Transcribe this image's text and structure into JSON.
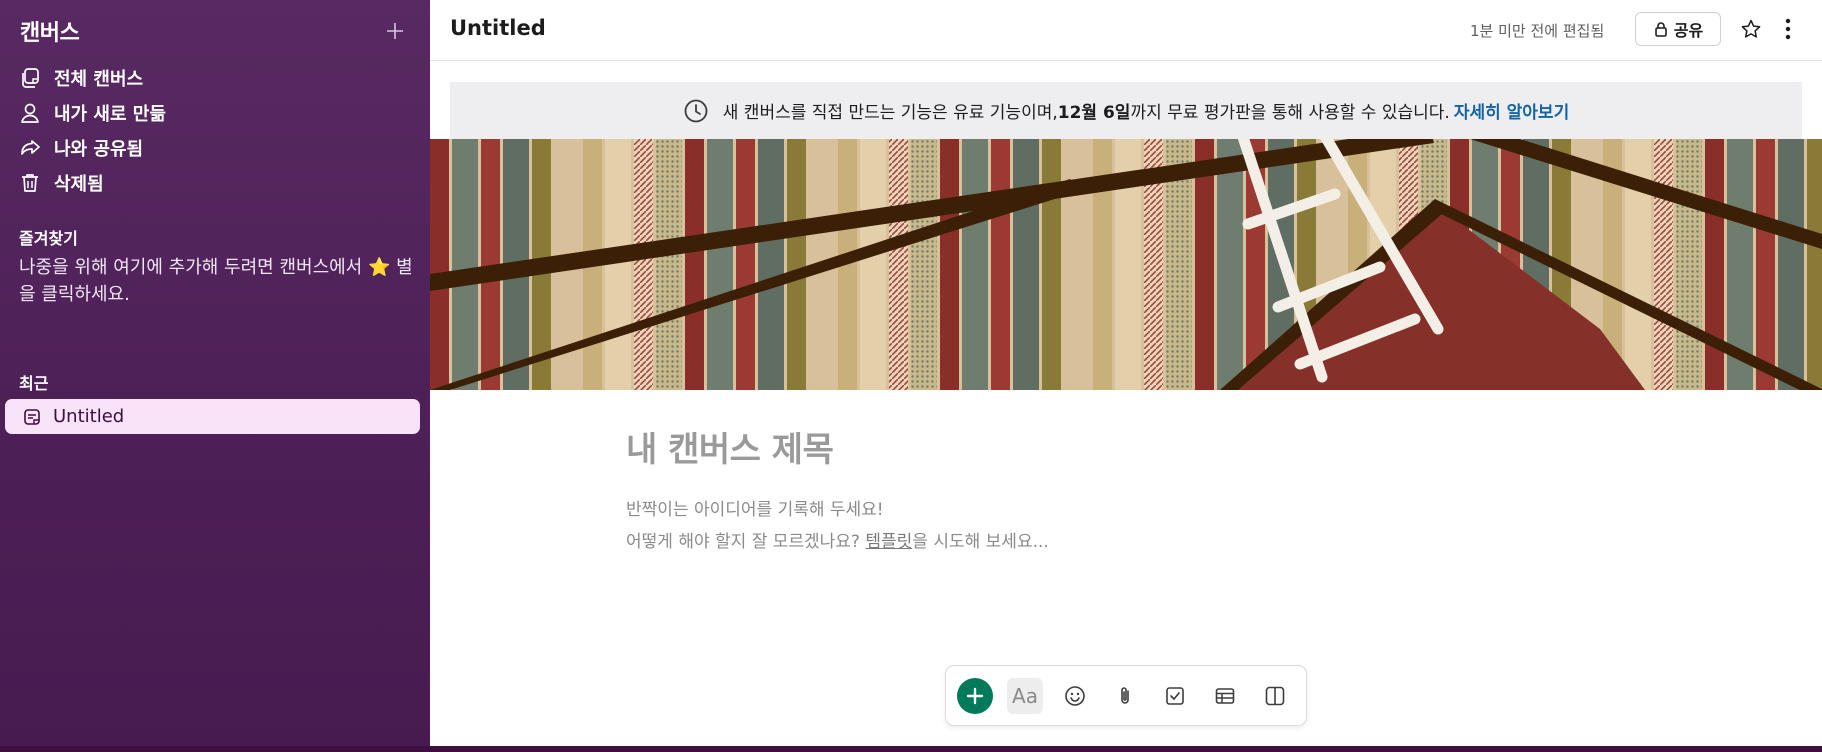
{
  "sidebar": {
    "title": "캔버스",
    "nav": [
      {
        "label": "전체 캔버스",
        "icon": "canvases-icon"
      },
      {
        "label": "내가 새로 만듦",
        "icon": "person-icon"
      },
      {
        "label": "나와 공유됨",
        "icon": "share-arrow-icon"
      },
      {
        "label": "삭제됨",
        "icon": "trash-icon"
      }
    ],
    "favorites": {
      "title": "즐겨찾기",
      "text": "나중을 위해 여기에 추가해 두려면 캔버스에서 ⭐ 별을 클릭하세요."
    },
    "recent": {
      "title": "최근",
      "items": [
        {
          "label": "Untitled",
          "icon": "canvas-doc-icon"
        }
      ]
    }
  },
  "header": {
    "title": "Untitled",
    "edited": "1분 미만 전에 편집됨",
    "share_label": "공유"
  },
  "banner": {
    "text_before": "새 캔버스를 직접 만드는 기능은 유료 기능이며, ",
    "date": "12월 6일",
    "text_after": "까지 무료 평가판을 통해 사용할 수 있습니다.",
    "link": "자세히 알아보기"
  },
  "canvas": {
    "title_placeholder": "내 캔버스 제목",
    "hint_line1": "반짝이는 아이디어를 기록해 두세요!",
    "hint_line2_before": "어떻게 해야 할지 잘 모르겠나요? ",
    "hint_template_link": "템플릿",
    "hint_line2_after": "을 시도해 보세요..."
  },
  "toolbar": {
    "format_label": "Aa",
    "buttons": [
      "plus-icon",
      "text-format-icon",
      "emoji-icon",
      "attachment-icon",
      "checklist-icon",
      "table-icon",
      "columns-icon"
    ]
  },
  "colors": {
    "sidebar_bg": "#582962",
    "accent_green": "#007a5a",
    "link_blue": "#1264a3",
    "recent_highlight": "#f8e3f8"
  }
}
